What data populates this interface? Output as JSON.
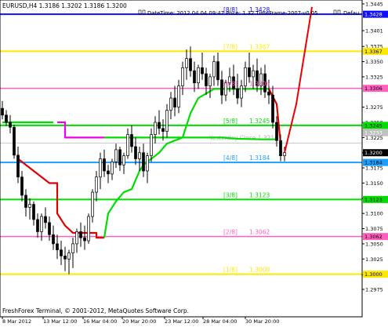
{
  "header": {
    "symbol_line": "EURUSD,H4  1.3186 1.3202 1.3186 1.3200",
    "info_line": "DateTime: 2012.04.04 09:47   Price: 1.32   TimeFrame-2007-v0.05",
    "truncated_label": "Defau"
  },
  "footer": {
    "copyright": "FreshForex Terminal, © 2001-2012, MetaQuotes Software Corp."
  },
  "yesterday_close": "Yesterday Close 1.3216",
  "colors": {
    "background": "#ffffff",
    "candles": "#000000",
    "level_8_8": "#1010ff",
    "level_7_8": "#ffe800",
    "level_6_8": "#ff5fbf",
    "level_5_8": "#00dd00",
    "level_4_8": "#1a9fff",
    "level_3_8": "#00dd00",
    "level_2_8": "#ff5fbf",
    "level_1_8": "#ffe800",
    "stop_green": "#00dd00",
    "stop_red": "#dd0000",
    "magenta": "#ee00ee",
    "forecast": "#ee0000"
  },
  "chart_data": {
    "type": "candlestick",
    "symbol": "EURUSD",
    "timeframe": "H4",
    "ylim": [
      1.2975,
      1.3445
    ],
    "x_tick_labels": [
      "8 Mar 2012",
      "13 Mar 12:00",
      "16 Mar 04:00",
      "20 Mar 20:00",
      "23 Mar 12:00",
      "28 Mar 04:00",
      "30 Mar 20:00"
    ],
    "y_tick_labels": [
      1.3445,
      1.3401,
      1.3375,
      1.335,
      1.3325,
      1.3275,
      1.325,
      1.3225,
      1.32,
      1.3175,
      1.315,
      1.3125,
      1.31,
      1.3075,
      1.305,
      1.3025,
      1.2999,
      1.2975
    ],
    "price_badges": [
      {
        "label": "1.3428",
        "value": 1.3428,
        "bg": "#1010ff",
        "fg": "#ffffff"
      },
      {
        "label": "1.3367",
        "value": 1.3367,
        "bg": "#ffe800",
        "fg": "#000000"
      },
      {
        "label": "1.3306",
        "value": 1.3306,
        "bg": "#ff5fbf",
        "fg": "#000000"
      },
      {
        "label": "1.3245",
        "value": 1.3245,
        "bg": "#00dd00",
        "fg": "#000000"
      },
      {
        "label": "1.3233",
        "value": 1.3233,
        "bg": "#c0c0c0",
        "fg": "#ffffff"
      },
      {
        "label": "1.3200",
        "value": 1.32,
        "bg": "#000000",
        "fg": "#ffffff"
      },
      {
        "label": "1.3184",
        "value": 1.3184,
        "bg": "#1a9fff",
        "fg": "#000000"
      },
      {
        "label": "1.3123",
        "value": 1.3123,
        "bg": "#00dd00",
        "fg": "#000000"
      },
      {
        "label": "1.3062",
        "value": 1.3062,
        "bg": "#ff5fbf",
        "fg": "#000000"
      },
      {
        "label": "1.3000",
        "value": 1.3,
        "bg": "#ffe800",
        "fg": "#000000"
      }
    ],
    "murrey_levels": [
      {
        "label": "[8/8]",
        "value_text": "1.3428",
        "value": 1.3428,
        "color": "#1010ff",
        "width": 2
      },
      {
        "label": "[7/8]",
        "value_text": "1.3367",
        "value": 1.3367,
        "color": "#ffe800",
        "width": 2
      },
      {
        "label": "[6/8]",
        "value_text": "1.3306",
        "value": 1.3306,
        "color": "#ff5fbf",
        "width": 1.5
      },
      {
        "label": "[5/8]",
        "value_text": "1.3245",
        "value": 1.3245,
        "color": "#00dd00",
        "width": 2
      },
      {
        "label": "[4/8]",
        "value_text": "1.3184",
        "value": 1.3184,
        "color": "#1a9fff",
        "width": 2
      },
      {
        "label": "[3/8]",
        "value_text": "1.3123",
        "value": 1.3123,
        "color": "#00dd00",
        "width": 2
      },
      {
        "label": "[2/8]",
        "value_text": "1.3062",
        "value": 1.3062,
        "color": "#ff5fbf",
        "width": 1.5
      },
      {
        "label": "[1/8]",
        "value_text": "1.3000",
        "value": 1.3,
        "color": "#ffe800",
        "width": 2
      }
    ],
    "yesterday_close_value": 1.3216,
    "candles": [
      [
        1.3273,
        1.3285,
        1.3255,
        1.3262
      ],
      [
        1.3262,
        1.327,
        1.3244,
        1.325
      ],
      [
        1.325,
        1.3262,
        1.3232,
        1.3242
      ],
      [
        1.3242,
        1.3246,
        1.319,
        1.3196
      ],
      [
        1.3196,
        1.321,
        1.315,
        1.316
      ],
      [
        1.316,
        1.317,
        1.312,
        1.313
      ],
      [
        1.313,
        1.314,
        1.3095,
        1.311
      ],
      [
        1.311,
        1.3125,
        1.309,
        1.3115
      ],
      [
        1.3115,
        1.312,
        1.308,
        1.309
      ],
      [
        1.309,
        1.31,
        1.306,
        1.307
      ],
      [
        1.307,
        1.31,
        1.3055,
        1.3095
      ],
      [
        1.3095,
        1.311,
        1.3075,
        1.3085
      ],
      [
        1.3085,
        1.3095,
        1.3055,
        1.3065
      ],
      [
        1.3065,
        1.308,
        1.304,
        1.305
      ],
      [
        1.305,
        1.3065,
        1.3025,
        1.304
      ],
      [
        1.304,
        1.3055,
        1.3015,
        1.303
      ],
      [
        1.303,
        1.3045,
        1.3005,
        1.3025
      ],
      [
        1.3025,
        1.304,
        1.3,
        1.3035
      ],
      [
        1.3035,
        1.306,
        1.301,
        1.305
      ],
      [
        1.305,
        1.3075,
        1.3035,
        1.307
      ],
      [
        1.307,
        1.3085,
        1.3045,
        1.306
      ],
      [
        1.306,
        1.308,
        1.304,
        1.3055
      ],
      [
        1.3055,
        1.31,
        1.305,
        1.3095
      ],
      [
        1.3095,
        1.314,
        1.3085,
        1.3135
      ],
      [
        1.3135,
        1.317,
        1.312,
        1.316
      ],
      [
        1.316,
        1.32,
        1.314,
        1.319
      ],
      [
        1.319,
        1.3205,
        1.316,
        1.317
      ],
      [
        1.317,
        1.318,
        1.315,
        1.3165
      ],
      [
        1.3165,
        1.319,
        1.3155,
        1.3185
      ],
      [
        1.3185,
        1.3215,
        1.3175,
        1.3205
      ],
      [
        1.3205,
        1.321,
        1.317,
        1.318
      ],
      [
        1.318,
        1.32,
        1.3165,
        1.3195
      ],
      [
        1.3195,
        1.324,
        1.319,
        1.323
      ],
      [
        1.323,
        1.3245,
        1.32,
        1.321
      ],
      [
        1.321,
        1.3225,
        1.318,
        1.319
      ],
      [
        1.319,
        1.321,
        1.317,
        1.32
      ],
      [
        1.32,
        1.3215,
        1.316,
        1.317
      ],
      [
        1.317,
        1.32,
        1.315,
        1.3195
      ],
      [
        1.3195,
        1.324,
        1.3185,
        1.323
      ],
      [
        1.323,
        1.326,
        1.3215,
        1.325
      ],
      [
        1.325,
        1.327,
        1.323,
        1.324
      ],
      [
        1.324,
        1.3255,
        1.322,
        1.3235
      ],
      [
        1.3235,
        1.328,
        1.3225,
        1.327
      ],
      [
        1.327,
        1.33,
        1.3255,
        1.329
      ],
      [
        1.329,
        1.331,
        1.326,
        1.3275
      ],
      [
        1.3275,
        1.332,
        1.3265,
        1.331
      ],
      [
        1.331,
        1.335,
        1.3295,
        1.334
      ],
      [
        1.334,
        1.337,
        1.332,
        1.3355
      ],
      [
        1.3355,
        1.3375,
        1.3325,
        1.3335
      ],
      [
        1.3335,
        1.335,
        1.33,
        1.3315
      ],
      [
        1.3315,
        1.3345,
        1.3305,
        1.334
      ],
      [
        1.334,
        1.3365,
        1.332,
        1.333
      ],
      [
        1.333,
        1.334,
        1.3295,
        1.331
      ],
      [
        1.331,
        1.333,
        1.329,
        1.3325
      ],
      [
        1.3325,
        1.336,
        1.331,
        1.335
      ],
      [
        1.335,
        1.3365,
        1.331,
        1.332
      ],
      [
        1.332,
        1.3335,
        1.328,
        1.3295
      ],
      [
        1.3295,
        1.332,
        1.3285,
        1.3315
      ],
      [
        1.3315,
        1.334,
        1.33,
        1.3325
      ],
      [
        1.3325,
        1.3345,
        1.3295,
        1.3305
      ],
      [
        1.3305,
        1.333,
        1.328,
        1.329
      ],
      [
        1.329,
        1.332,
        1.3275,
        1.331
      ],
      [
        1.331,
        1.335,
        1.33,
        1.334
      ],
      [
        1.334,
        1.3365,
        1.3315,
        1.3325
      ],
      [
        1.3325,
        1.3345,
        1.3305,
        1.3335
      ],
      [
        1.3335,
        1.3355,
        1.33,
        1.331
      ],
      [
        1.331,
        1.334,
        1.3295,
        1.333
      ],
      [
        1.333,
        1.3345,
        1.329,
        1.33
      ],
      [
        1.33,
        1.332,
        1.328,
        1.3295
      ],
      [
        1.3295,
        1.331,
        1.324,
        1.325
      ],
      [
        1.325,
        1.326,
        1.321,
        1.322
      ],
      [
        1.322,
        1.323,
        1.3186,
        1.3195
      ],
      [
        1.3195,
        1.321,
        1.3186,
        1.32
      ]
    ],
    "series": [
      {
        "name": "",
        "color": "#00dd00",
        "points": [
          [
            0,
            1.325
          ],
          [
            2,
            1.325
          ],
          [
            4,
            1.325
          ],
          [
            6,
            1.325
          ],
          [
            7,
            1.325
          ],
          [
            8,
            1.325
          ],
          [
            10,
            1.325
          ],
          [
            12,
            1.325
          ],
          [
            13,
            1.325
          ]
        ]
      },
      {
        "name": "",
        "color": "#ee00ee",
        "points": [
          [
            14,
            1.325
          ],
          [
            16,
            1.325
          ],
          [
            16,
            1.3225
          ],
          [
            25,
            1.3225
          ],
          [
            26,
            1.3225
          ]
        ]
      },
      {
        "name": "",
        "color": "#00dd00",
        "points": [
          [
            26,
            1.3225
          ],
          [
            56,
            1.3225
          ],
          [
            60,
            1.3223
          ],
          [
            66,
            1.3222
          ],
          [
            70,
            1.3222
          ]
        ]
      },
      {
        "name": "",
        "color": "#dd0000",
        "points": [
          [
            4,
            1.319
          ],
          [
            8,
            1.317
          ],
          [
            12,
            1.315
          ],
          [
            14,
            1.315
          ],
          [
            14,
            1.31
          ],
          [
            16,
            1.308
          ],
          [
            18,
            1.3068
          ],
          [
            24,
            1.3068
          ],
          [
            24,
            1.306
          ],
          [
            26,
            1.306
          ]
        ]
      },
      {
        "name": "",
        "color": "#00dd00",
        "points": [
          [
            26,
            1.306
          ],
          [
            27,
            1.31
          ],
          [
            29,
            1.312
          ],
          [
            31,
            1.3135
          ],
          [
            33,
            1.314
          ],
          [
            35,
            1.317
          ],
          [
            36,
            1.318
          ],
          [
            38,
            1.319
          ],
          [
            40,
            1.32
          ],
          [
            42,
            1.3215
          ],
          [
            46,
            1.3225
          ],
          [
            48,
            1.3265
          ],
          [
            50,
            1.329
          ],
          [
            54,
            1.3305
          ],
          [
            62,
            1.3305
          ],
          [
            68,
            1.3305
          ]
        ]
      },
      {
        "name": "",
        "color": "#dd0000",
        "points": [
          [
            68,
            1.3305
          ],
          [
            70,
            1.328
          ],
          [
            71,
            1.3215
          ]
        ]
      }
    ],
    "forecast": {
      "color": "#ee0000",
      "points": [
        [
          72,
          1.32
        ],
        [
          75,
          1.328
        ],
        [
          79,
          1.344
        ]
      ]
    }
  }
}
